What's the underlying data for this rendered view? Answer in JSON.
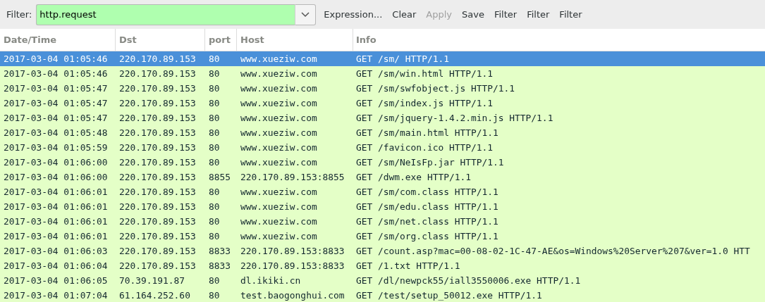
{
  "filter": {
    "label": "Filter:",
    "value": "http.request",
    "valid": true
  },
  "buttons": [
    {
      "label": "Expression...",
      "disabled": false
    },
    {
      "label": "Clear",
      "disabled": false
    },
    {
      "label": "Apply",
      "disabled": true
    },
    {
      "label": "Save",
      "disabled": false
    },
    {
      "label": "Filter",
      "disabled": false
    },
    {
      "label": "Filter",
      "disabled": false
    },
    {
      "label": "Filter",
      "disabled": false
    }
  ],
  "table": {
    "columns": [
      "Date/Time",
      "Dst",
      "port",
      "Host",
      "Info"
    ],
    "rows": [
      {
        "cells": [
          "2017-03-04 01:05:46",
          "220.170.89.153",
          "80",
          "www.xueziw.com",
          "GET /sm/ HTTP/1.1"
        ],
        "selected": true
      },
      {
        "cells": [
          "2017-03-04 01:05:46",
          "220.170.89.153",
          "80",
          "www.xueziw.com",
          "GET /sm/win.html HTTP/1.1"
        ],
        "selected": false
      },
      {
        "cells": [
          "2017-03-04 01:05:47",
          "220.170.89.153",
          "80",
          "www.xueziw.com",
          "GET /sm/swfobject.js HTTP/1.1"
        ],
        "selected": false
      },
      {
        "cells": [
          "2017-03-04 01:05:47",
          "220.170.89.153",
          "80",
          "www.xueziw.com",
          "GET /sm/index.js HTTP/1.1"
        ],
        "selected": false
      },
      {
        "cells": [
          "2017-03-04 01:05:47",
          "220.170.89.153",
          "80",
          "www.xueziw.com",
          "GET /sm/jquery-1.4.2.min.js HTTP/1.1"
        ],
        "selected": false
      },
      {
        "cells": [
          "2017-03-04 01:05:48",
          "220.170.89.153",
          "80",
          "www.xueziw.com",
          "GET /sm/main.html HTTP/1.1"
        ],
        "selected": false
      },
      {
        "cells": [
          "2017-03-04 01:05:59",
          "220.170.89.153",
          "80",
          "www.xueziw.com",
          "GET /favicon.ico HTTP/1.1"
        ],
        "selected": false
      },
      {
        "cells": [
          "2017-03-04 01:06:00",
          "220.170.89.153",
          "80",
          "www.xueziw.com",
          "GET /sm/NeIsFp.jar HTTP/1.1"
        ],
        "selected": false
      },
      {
        "cells": [
          "2017-03-04 01:06:00",
          "220.170.89.153",
          "8855",
          "220.170.89.153:8855",
          "GET /dwm.exe HTTP/1.1"
        ],
        "selected": false
      },
      {
        "cells": [
          "2017-03-04 01:06:01",
          "220.170.89.153",
          "80",
          "www.xueziw.com",
          "GET /sm/com.class HTTP/1.1"
        ],
        "selected": false
      },
      {
        "cells": [
          "2017-03-04 01:06:01",
          "220.170.89.153",
          "80",
          "www.xueziw.com",
          "GET /sm/edu.class HTTP/1.1"
        ],
        "selected": false
      },
      {
        "cells": [
          "2017-03-04 01:06:01",
          "220.170.89.153",
          "80",
          "www.xueziw.com",
          "GET /sm/net.class HTTP/1.1"
        ],
        "selected": false
      },
      {
        "cells": [
          "2017-03-04 01:06:01",
          "220.170.89.153",
          "80",
          "www.xueziw.com",
          "GET /sm/org.class HTTP/1.1"
        ],
        "selected": false
      },
      {
        "cells": [
          "2017-03-04 01:06:03",
          "220.170.89.153",
          "8833",
          "220.170.89.153:8833",
          "GET /count.asp?mac=00-08-02-1C-47-AE&os=Windows%20Server%207&ver=1.0 HTT"
        ],
        "selected": false
      },
      {
        "cells": [
          "2017-03-04 01:06:04",
          "220.170.89.153",
          "8833",
          "220.170.89.153:8833",
          "GET /1.txt HTTP/1.1"
        ],
        "selected": false
      },
      {
        "cells": [
          "2017-03-04 01:06:05",
          "70.39.191.87",
          "80",
          "dl.ikiki.cn",
          "GET /dl/newpck55/iall3550006.exe HTTP/1.1"
        ],
        "selected": false
      },
      {
        "cells": [
          "2017-03-04 01:07:04",
          "61.164.252.60",
          "80",
          "test.baogonghui.com",
          "GET /test/setup_50012.exe HTTP/1.1"
        ],
        "selected": false
      }
    ]
  }
}
